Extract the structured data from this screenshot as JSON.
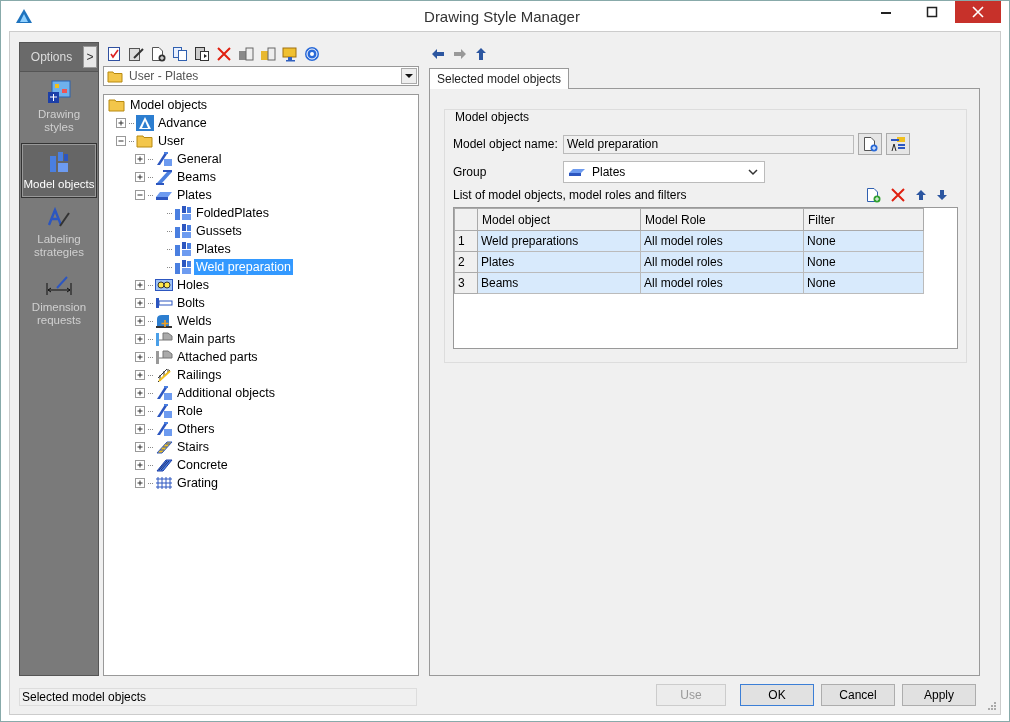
{
  "window": {
    "title": "Drawing Style Manager"
  },
  "sidebar": {
    "header": "Options",
    "toggle": ">",
    "items": [
      {
        "label": "Drawing styles",
        "kind": "styles",
        "selected": false
      },
      {
        "label": "Model objects",
        "kind": "objects",
        "selected": true
      },
      {
        "label": "Labeling strategies",
        "kind": "labeling",
        "selected": false
      },
      {
        "label": "Dimension requests",
        "kind": "dimension",
        "selected": false
      }
    ]
  },
  "path_combo": {
    "value": "User - Plates"
  },
  "tree": [
    {
      "label": "Model objects",
      "kind": "folder",
      "selected": false,
      "children": [
        {
          "label": "Advance",
          "kind": "advance",
          "expanded": false,
          "selected": false
        },
        {
          "label": "User",
          "kind": "folder",
          "expanded": true,
          "selected": false,
          "children": [
            {
              "label": "General",
              "kind": "member",
              "expanded": false,
              "selected": false
            },
            {
              "label": "Beams",
              "kind": "beam",
              "expanded": false,
              "selected": false
            },
            {
              "label": "Plates",
              "kind": "plate",
              "expanded": true,
              "selected": false,
              "children": [
                {
                  "label": "FoldedPlates",
                  "kind": "object",
                  "selected": false
                },
                {
                  "label": "Gussets",
                  "kind": "object",
                  "selected": false
                },
                {
                  "label": "Plates",
                  "kind": "object",
                  "selected": false
                },
                {
                  "label": "Weld preparation",
                  "kind": "object",
                  "selected": true
                }
              ]
            },
            {
              "label": "Holes",
              "kind": "holes",
              "expanded": false,
              "selected": false
            },
            {
              "label": "Bolts",
              "kind": "bolt",
              "expanded": false,
              "selected": false
            },
            {
              "label": "Welds",
              "kind": "weld",
              "expanded": false,
              "selected": false
            },
            {
              "label": "Main parts",
              "kind": "part",
              "expanded": false,
              "selected": false
            },
            {
              "label": "Attached parts",
              "kind": "attached",
              "expanded": false,
              "selected": false
            },
            {
              "label": "Railings",
              "kind": "railing",
              "expanded": false,
              "selected": false
            },
            {
              "label": "Additional objects",
              "kind": "member",
              "expanded": false,
              "selected": false
            },
            {
              "label": "Role",
              "kind": "member",
              "expanded": false,
              "selected": false
            },
            {
              "label": "Others",
              "kind": "member",
              "expanded": false,
              "selected": false
            },
            {
              "label": "Stairs",
              "kind": "stairs",
              "expanded": false,
              "selected": false
            },
            {
              "label": "Concrete",
              "kind": "concrete",
              "expanded": false,
              "selected": false
            },
            {
              "label": "Grating",
              "kind": "grating",
              "expanded": false,
              "selected": false
            }
          ]
        }
      ]
    }
  ],
  "tabs": [
    {
      "label": "Selected model objects",
      "selected": true
    }
  ],
  "model_objects": {
    "title": "Model objects",
    "name_label": "Model object name:",
    "name_value": "Weld preparation",
    "group_label": "Group",
    "group_value": "Plates",
    "list_label": "List of model objects, model roles and filters",
    "table": {
      "columns": [
        "Model object",
        "Model Role",
        "Filter"
      ],
      "rows": [
        {
          "index": "1",
          "cells": [
            "Weld preparations",
            "All model roles",
            "None"
          ]
        },
        {
          "index": "2",
          "cells": [
            "Plates",
            "All model roles",
            "None"
          ]
        },
        {
          "index": "3",
          "cells": [
            "Beams",
            "All model roles",
            "None"
          ]
        }
      ]
    }
  },
  "status_bar": "Selected model objects",
  "buttons": [
    {
      "label": "Use",
      "disabled": true,
      "default": false
    },
    {
      "label": "OK",
      "disabled": false,
      "default": true
    },
    {
      "label": "Cancel",
      "disabled": false,
      "default": false
    },
    {
      "label": "Apply",
      "disabled": false,
      "default": false
    }
  ]
}
